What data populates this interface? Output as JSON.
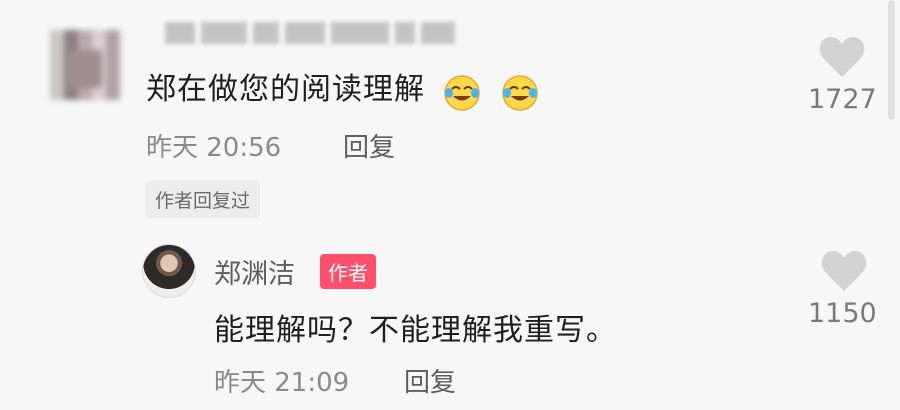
{
  "comment1": {
    "text": "郑在做您的阅读理解",
    "emoji_icon": "crying-laughing-face-icon",
    "date": "昨天 20:56",
    "reply_label": "回复",
    "likes": "1727",
    "author_replied_badge": "作者回复过"
  },
  "reply": {
    "username": "郑渊洁",
    "author_tag": "作者",
    "text": "能理解吗？不能理解我重写。",
    "date": "昨天 21:09",
    "reply_label": "回复",
    "likes": "1150"
  },
  "colors": {
    "background": "#f7f7f7",
    "author_tag": "#fe4f6d",
    "heart": "#d3d3d3"
  }
}
